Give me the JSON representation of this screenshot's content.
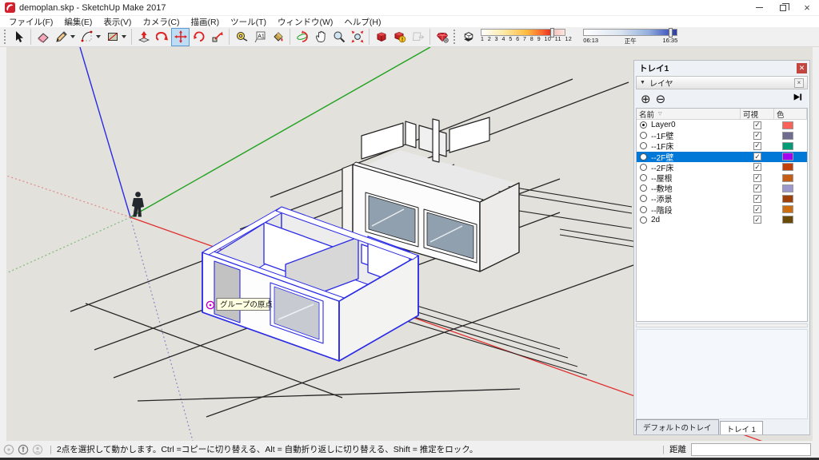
{
  "window": {
    "title": "demoplan.skp - SketchUp Make 2017",
    "controls": [
      "minimize",
      "restore",
      "close"
    ]
  },
  "menu": {
    "items": [
      "ファイル(F)",
      "編集(E)",
      "表示(V)",
      "カメラ(C)",
      "描画(R)",
      "ツール(T)",
      "ウィンドウ(W)",
      "ヘルプ(H)"
    ]
  },
  "toolbar": {
    "icons": [
      "select",
      "eraser",
      "line",
      "arc",
      "rectangle",
      "push-pull",
      "follow-me",
      "move",
      "rotate",
      "scale",
      "tape-measure",
      "text",
      "paint-bucket",
      "orbit",
      "pan",
      "zoom",
      "zoom-extents",
      "3d-warehouse",
      "model-check",
      "share-component",
      "extension-warehouse",
      "shadows-toggle"
    ],
    "active_tool": "move",
    "shadow_months_label": "1 2 3 4 5 6 7 8 9 10 11 12",
    "shadow_months": [
      "1",
      "2",
      "3",
      "4",
      "5",
      "6",
      "7",
      "8",
      "9",
      "10",
      "11",
      "12"
    ],
    "time_start": "06:13",
    "time_noon": "正午",
    "time_end": "16:35"
  },
  "viewport": {
    "tooltip": "グループの原点"
  },
  "tray": {
    "title": "トレイ1",
    "section": "レイヤ",
    "buttons": [
      "add-layer",
      "remove-layer",
      "details"
    ],
    "columns": {
      "name": "名前",
      "visible": "可視",
      "color": "色"
    },
    "layers": [
      {
        "name": "Layer0",
        "radio": true,
        "visible": true,
        "color": "#F96159",
        "selected": false
      },
      {
        "name": "--1F壁",
        "radio": false,
        "visible": true,
        "color": "#6F6C90",
        "selected": false
      },
      {
        "name": "--1F床",
        "radio": false,
        "visible": true,
        "color": "#009C78",
        "selected": false
      },
      {
        "name": "--2F壁",
        "radio": false,
        "visible": true,
        "color": "#A400F2",
        "selected": true
      },
      {
        "name": "--2F床",
        "radio": false,
        "visible": true,
        "color": "#C33E08",
        "selected": false
      },
      {
        "name": "--屋根",
        "radio": false,
        "visible": true,
        "color": "#C55E12",
        "selected": false
      },
      {
        "name": "--敷地",
        "radio": false,
        "visible": true,
        "color": "#9C98CE",
        "selected": false
      },
      {
        "name": "--添景",
        "radio": false,
        "visible": true,
        "color": "#A04009",
        "selected": false
      },
      {
        "name": "--階段",
        "radio": false,
        "visible": true,
        "color": "#CC6E10",
        "selected": false
      },
      {
        "name": "2d",
        "radio": false,
        "visible": true,
        "color": "#6B4A06",
        "selected": false
      }
    ],
    "tabs": [
      "デフォルトのトレイ",
      "トレイ 1"
    ],
    "active_tab": "トレイ 1"
  },
  "statusbar": {
    "message": "2点を選択して動かします。Ctrl =コピーに切り替える、Alt = 自動折り返しに切り替える、Shift = 推定をロック。",
    "measure_label": "距離",
    "measure_value": ""
  },
  "colors": {
    "selection_highlight": "#0078D7",
    "axis_blue": "#2A2AE6",
    "axis_green": "#1FA11F",
    "axis_red": "#E03030",
    "selected_geometry": "#2A2AE6",
    "viewport_background": "#E2E1DB"
  }
}
